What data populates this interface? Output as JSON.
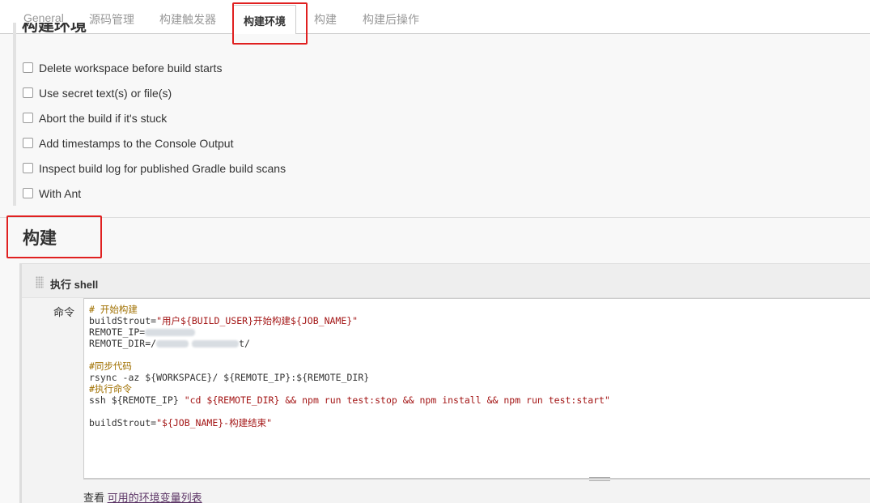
{
  "tabs": [
    {
      "label": "General",
      "active": false
    },
    {
      "label": "源码管理",
      "active": false
    },
    {
      "label": "构建触发器",
      "active": false
    },
    {
      "label": "构建环境",
      "active": true
    },
    {
      "label": "构建",
      "active": false
    },
    {
      "label": "构建后操作",
      "active": false
    }
  ],
  "build_env": {
    "heading": "构建环境",
    "options": [
      {
        "label": "Delete workspace before build starts",
        "checked": false
      },
      {
        "label": "Use secret text(s) or file(s)",
        "checked": false
      },
      {
        "label": "Abort the build if it's stuck",
        "checked": false
      },
      {
        "label": "Add timestamps to the Console Output",
        "checked": false
      },
      {
        "label": "Inspect build log for published Gradle build scans",
        "checked": false
      },
      {
        "label": "With Ant",
        "checked": false
      }
    ]
  },
  "build": {
    "title": "构建",
    "step_title": "执行 shell",
    "command_label": "命令",
    "code": {
      "l1": "# 开始构建",
      "l2_a": "buildStrout=",
      "l2_b": "\"用户${BUILD_USER}开始构建${JOB_NAME}\"",
      "l3_a": "REMOTE_IP=",
      "l4_a": "REMOTE_DIR=/",
      "l4_b": "t/",
      "l6": "#同步代码",
      "l7": "rsync -az ${WORKSPACE}/ ${REMOTE_IP}:${REMOTE_DIR}",
      "l8": "#执行命令",
      "l9_a": "ssh ${REMOTE_IP} ",
      "l9_b": "\"cd ${REMOTE_DIR} && npm run test:stop && npm install && npm run test:start\"",
      "l11_a": "buildStrout=",
      "l11_b": "\"${JOB_NAME}-构建结束\""
    },
    "env_prefix": "查看",
    "env_link": "可用的环境变量列表"
  },
  "colors": {
    "highlight_box": "#e02020",
    "comment": "#a07000",
    "string": "#a31515",
    "link": "#5c3566"
  }
}
